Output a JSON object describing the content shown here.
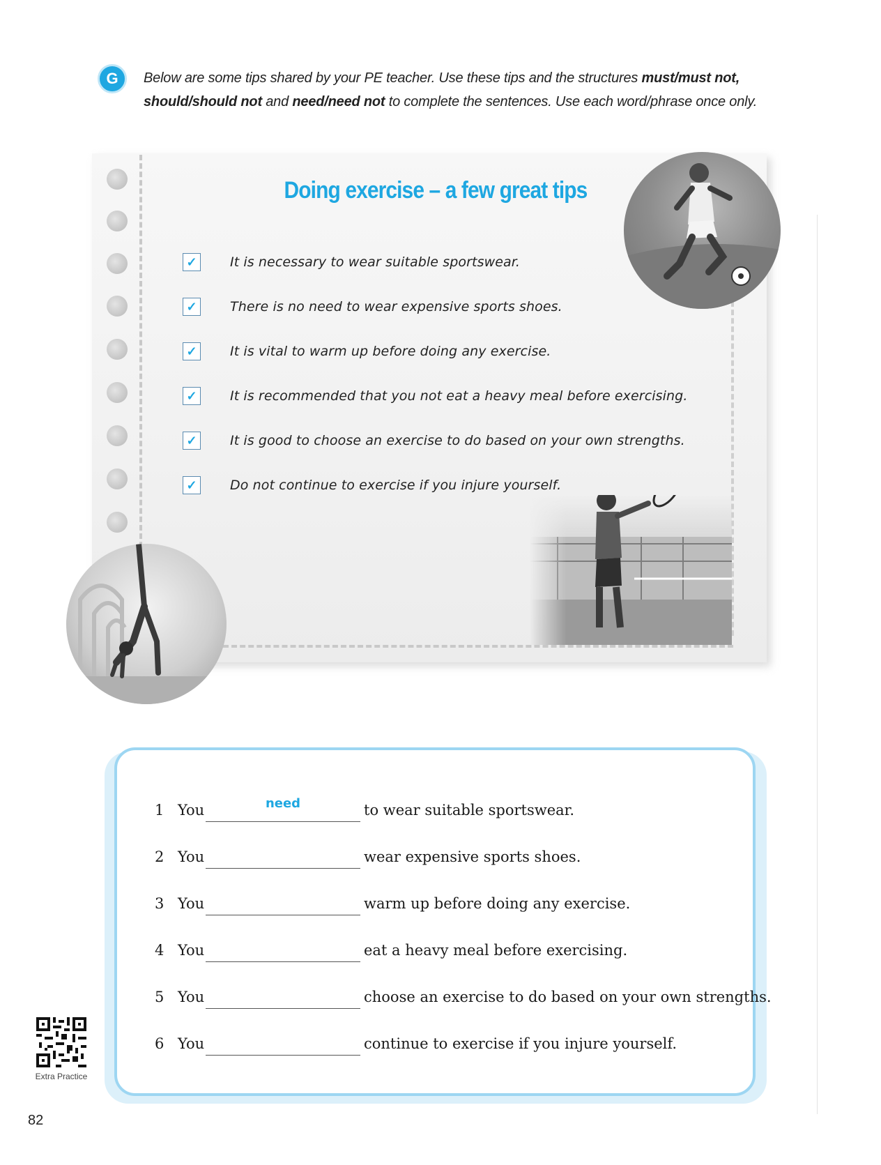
{
  "header": {
    "badge": "G",
    "instruction_parts": [
      {
        "text": "Below are some tips shared by your PE teacher. Use these tips and the structures ",
        "bold": false
      },
      {
        "text": "must/must not,",
        "bold": true
      },
      {
        "text": " ",
        "bold": false
      },
      {
        "text": "should/should not",
        "bold": true
      },
      {
        "text": " and ",
        "bold": false
      },
      {
        "text": "need/need not",
        "bold": true
      },
      {
        "text": " to complete the sentences. Use each word/phrase once only.",
        "bold": false
      }
    ]
  },
  "card": {
    "title": "Doing exercise – a few great tips",
    "check_mark": "✓",
    "tips": [
      "It is necessary to wear suitable sportswear.",
      "There is no need to wear expensive sports shoes.",
      "It is vital to warm up before doing any exercise.",
      "It is recommended that you not eat a heavy meal before exercising.",
      "It is good to choose an exercise to do based on your own strengths.",
      "Do not continue to exercise if you injure yourself."
    ]
  },
  "exercise": {
    "subject": "You",
    "items": [
      {
        "number": "1",
        "answer": "need",
        "rest": "to wear suitable sportswear."
      },
      {
        "number": "2",
        "answer": "",
        "rest": "wear expensive sports shoes."
      },
      {
        "number": "3",
        "answer": "",
        "rest": "warm up before doing any exercise."
      },
      {
        "number": "4",
        "answer": "",
        "rest": "eat a heavy meal before exercising."
      },
      {
        "number": "5",
        "answer": "",
        "rest": "choose an exercise to do based on your own strengths."
      },
      {
        "number": "6",
        "answer": "",
        "rest": "continue to exercise if you injure yourself."
      }
    ]
  },
  "footer": {
    "qr_label": "Extra Practice",
    "page_number": "82"
  },
  "colors": {
    "accent": "#1ea7e1",
    "answer_border": "#9dd6f2"
  }
}
